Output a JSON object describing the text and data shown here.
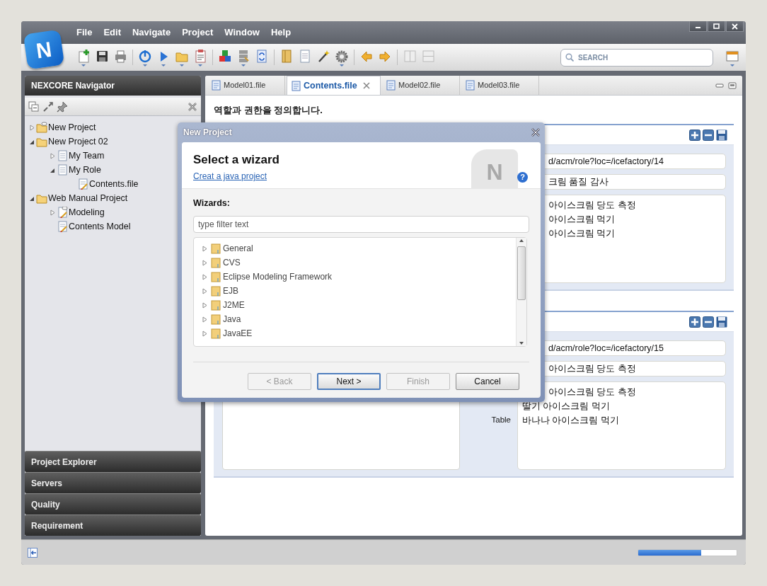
{
  "window": {
    "logo": "N",
    "menu": [
      "File",
      "Edit",
      "Navigate",
      "Project",
      "Window",
      "Help"
    ],
    "search": {
      "placeholder": "SEARCH"
    }
  },
  "navigator": {
    "title": "NEXCORE Navigator",
    "tree": [
      {
        "label": "New Project",
        "kind": "linkedfolder",
        "expandable": true,
        "expanded": false
      },
      {
        "label": "New Project 02",
        "kind": "folder",
        "expandable": true,
        "expanded": true,
        "children": [
          {
            "label": "My Team",
            "kind": "page",
            "expandable": true,
            "expanded": false
          },
          {
            "label": "My Role",
            "kind": "page",
            "expandable": true,
            "expanded": true,
            "children": [
              {
                "label": "Contents.file",
                "kind": "editpage",
                "expandable": false
              }
            ]
          }
        ]
      },
      {
        "label": "Web Manual Project",
        "kind": "folder",
        "expandable": true,
        "expanded": true,
        "children": [
          {
            "label": "Modeling",
            "kind": "linkededitpage",
            "expandable": true,
            "expanded": false
          },
          {
            "label": "Contents Model",
            "kind": "editpage",
            "expandable": false
          }
        ]
      }
    ],
    "views": [
      "Project Explorer",
      "Servers",
      "Quality",
      "Requirement"
    ]
  },
  "editor": {
    "tabs": [
      {
        "label": "Model01.file",
        "selected": false
      },
      {
        "label": "Contents.file",
        "selected": true
      },
      {
        "label": "Model02.file",
        "selected": false
      },
      {
        "label": "Model03.file",
        "selected": false
      }
    ],
    "description": "역할과 권한을 정의합니다.",
    "sections": [
      {
        "has_list": false,
        "fields": [
          {
            "kind": "line",
            "text": "d/acm/role?loc=/icefactory/14",
            "covered": true
          },
          {
            "kind": "line",
            "text": "크림 품질 감사",
            "covered": true
          },
          {
            "kind": "area",
            "lines": [
              {
                "text": "아이스크림 당도 측정",
                "covered": true
              },
              {
                "text": "아이스크림 먹기",
                "covered": true
              },
              {
                "text": "아이스크림 먹기",
                "covered": true
              }
            ]
          }
        ]
      },
      {
        "has_list": true,
        "fields": [
          {
            "kind": "line",
            "text": "d/acm/role?loc=/icefactory/15",
            "covered": true
          },
          {
            "kind": "line",
            "text": "아이스크림 당도 측정",
            "covered": true
          },
          {
            "kind": "area",
            "label": "Table",
            "lines": [
              {
                "text": "아이스크림 당도 측정",
                "covered": true
              },
              {
                "text": "딸기 아이스크림 먹기",
                "covered": false
              },
              {
                "text": "바나나 아이스크림 먹기",
                "covered": false
              }
            ]
          }
        ]
      }
    ]
  },
  "dialog": {
    "title": "New Project",
    "heading": "Select a wizard",
    "subtitle": "Creat a java project",
    "banner_letter": "N",
    "help": "?",
    "list_label": "Wizards:",
    "filter": {
      "placeholder": "type filter text"
    },
    "wizards": [
      "General",
      "CVS",
      "Eclipse Modeling Framework",
      "EJB",
      "J2ME",
      "Java",
      "JavaEE"
    ],
    "buttons": [
      {
        "label": "< Back",
        "disabled": true,
        "default": false
      },
      {
        "label": "Next >",
        "disabled": false,
        "default": true
      },
      {
        "label": "Finish",
        "disabled": true,
        "default": false
      },
      {
        "label": "Cancel",
        "disabled": false,
        "default": false
      }
    ]
  },
  "status_bar": {
    "progress": {
      "level": 0.64
    }
  }
}
